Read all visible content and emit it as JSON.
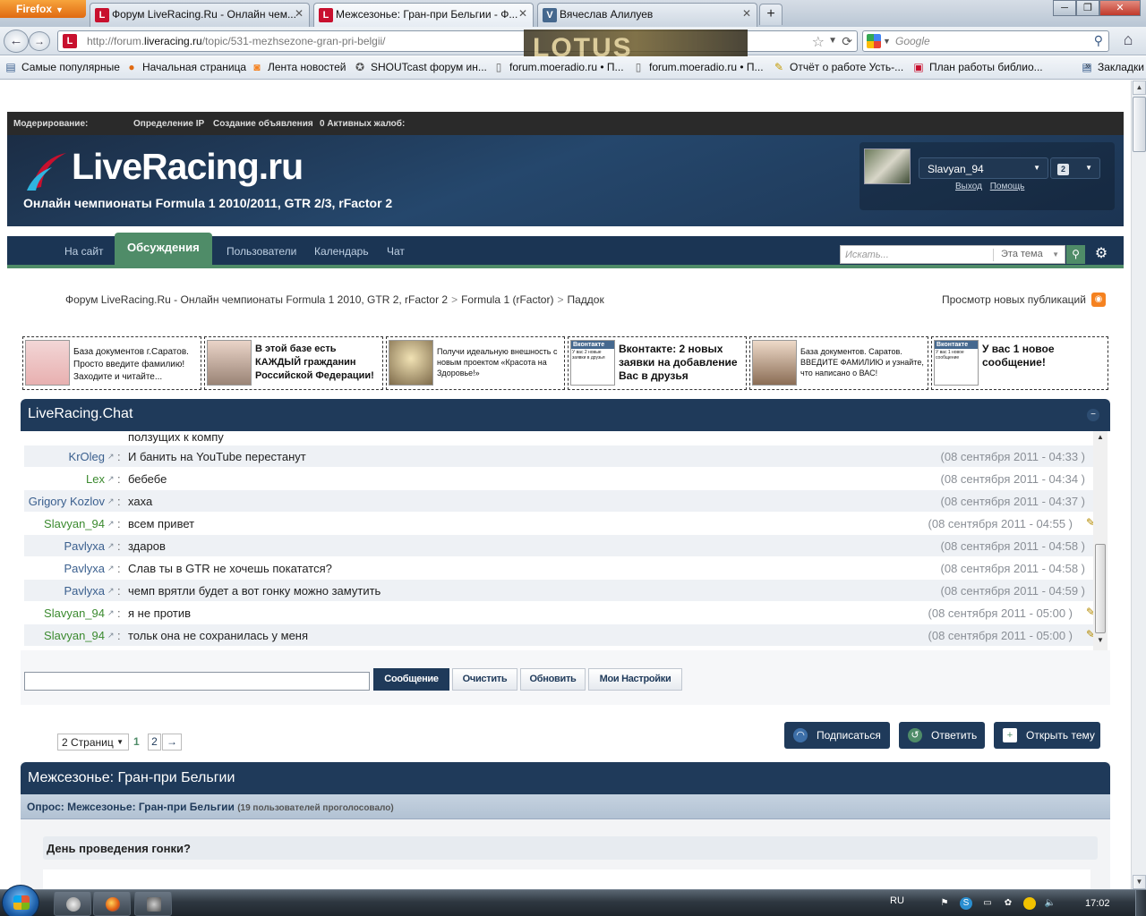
{
  "browser": {
    "menu_button": "Firefox",
    "tabs": [
      {
        "title": "Форум LiveRacing.Ru - Онлайн чем...",
        "favicon": "L",
        "color": "#c8102e"
      },
      {
        "title": "Межсезонье: Гран-при Бельгии - Ф...",
        "favicon": "L",
        "color": "#c8102e"
      },
      {
        "title": "Вячеслав Алилуев",
        "favicon": "V",
        "color": "#45688e"
      }
    ],
    "url": {
      "prefix": "http://forum.",
      "domain": "liveracing.ru",
      "path": "/topic/531-mezhsezone-gran-pri-belgii/"
    },
    "search_placeholder": "Google",
    "bookmarks": [
      "Самые популярные",
      "Начальная страница",
      "Лента новостей",
      "SHOUTcast форум ин...",
      "forum.moeradio.ru • П...",
      "forum.moeradio.ru • П...",
      "Отчёт о работе Усть-...",
      "План работы библио...",
      "Закладки"
    ],
    "persona_text": "LOTUS RENAULT GP"
  },
  "modbar": {
    "label": "Модерирование:",
    "links": [
      "Определение IP",
      "Создание объявления",
      "0 Активных жалоб:"
    ]
  },
  "header": {
    "logo": "LiveRacing.ru",
    "subtitle": "Онлайн чемпионаты Formula 1 2010/2011, GTR 2/3, rFactor 2",
    "username": "Slavyan_94",
    "notifications": "2",
    "links": [
      "Выход",
      "Помощь"
    ]
  },
  "nav": {
    "tabs": [
      "На сайт",
      "Обсуждения",
      "Пользователи",
      "Календарь",
      "Чат"
    ],
    "search_placeholder": "Искать...",
    "search_scope": "Эта тема"
  },
  "breadcrumb": [
    "Форум LiveRacing.Ru - Онлайн чемпионаты Formula 1 2010, GTR 2, rFactor 2",
    "Formula 1 (rFactor)",
    "Паддок"
  ],
  "new_posts": "Просмотр новых публикаций",
  "ads": [
    "База документов г.Саратов. Просто введите фамилию! Заходите и читайте...",
    "В этой базе есть КАЖДЫЙ гражданин Российской Федерации!",
    "Получи идеальную внешность с новым проектом «Красота на Здоровье!»",
    "Вконтакте: 2 новых заявки на добавление Вас в друзья",
    "База документов. Саратов. ВВЕДИТЕ ФАМИЛИЮ и узнайте, что написано о ВАС!",
    "У вас 1 новое сообщение!"
  ],
  "ad_thumb_labels": {
    "vk_brand": "Вконтакте",
    "vk1_text": "У вас 2 новые заявки в друзья",
    "vk2_text": "У вас 1 новое сообщение"
  },
  "chat": {
    "title": "LiveRacing.Chat",
    "partial_message": "ползущих к компу",
    "messages": [
      {
        "user": "KrOleg",
        "color": "blue",
        "text": "И банить на YouTube перестанут",
        "time": "(08 сентября 2011 - 04:33 )",
        "edit": false
      },
      {
        "user": "Lex",
        "color": "green",
        "text": "бебебе",
        "time": "(08 сентября 2011 - 04:34 )",
        "edit": false
      },
      {
        "user": "Grigory Kozlov",
        "color": "blue",
        "text": "хаха",
        "time": "(08 сентября 2011 - 04:37 )",
        "edit": false
      },
      {
        "user": "Slavyan_94",
        "color": "green",
        "text": "всем привет",
        "time": "(08 сентября 2011 - 04:55 )",
        "edit": true
      },
      {
        "user": "Pavlyxa",
        "color": "blue",
        "text": "здаров",
        "time": "(08 сентября 2011 - 04:58 )",
        "edit": false
      },
      {
        "user": "Pavlyxa",
        "color": "blue",
        "text": "Слав ты в GTR не хочешь покататся?",
        "time": "(08 сентября 2011 - 04:58 )",
        "edit": false
      },
      {
        "user": "Pavlyxa",
        "color": "blue",
        "text": "чемп врятли будет а вот гонку можно замутить",
        "time": "(08 сентября 2011 - 04:59 )",
        "edit": false
      },
      {
        "user": "Slavyan_94",
        "color": "green",
        "text": "я не против",
        "time": "(08 сентября 2011 - 05:00 )",
        "edit": true
      },
      {
        "user": "Slavyan_94",
        "color": "green",
        "text": "тольк она не сохранилась у меня",
        "time": "(08 сентября 2011 - 05:00 )",
        "edit": true
      }
    ],
    "buttons": [
      "Сообщение",
      "Очистить",
      "Обновить",
      "Мои Настройки"
    ],
    "input_value": ""
  },
  "pager": {
    "label": "2 Страниц",
    "current": "1",
    "pages": [
      "2"
    ],
    "next": "→"
  },
  "actions": [
    "Подписаться",
    "Ответить",
    "Открыть тему"
  ],
  "topic": {
    "title": "Межсезонье: Гран-при Бельгии",
    "poll_label": "Опрос: Межсезонье: Гран-при Бельгии",
    "poll_count": "(19 пользователей проголосовало)",
    "question": "День проведения гонки?"
  },
  "taskbar": {
    "lang": "RU",
    "clock": "17:02"
  },
  "colors": {
    "accent_navy": "#1f3a5a",
    "accent_green": "#4f8c68",
    "user_green": "#3b8a2f",
    "user_blue": "#3a5f8e"
  }
}
